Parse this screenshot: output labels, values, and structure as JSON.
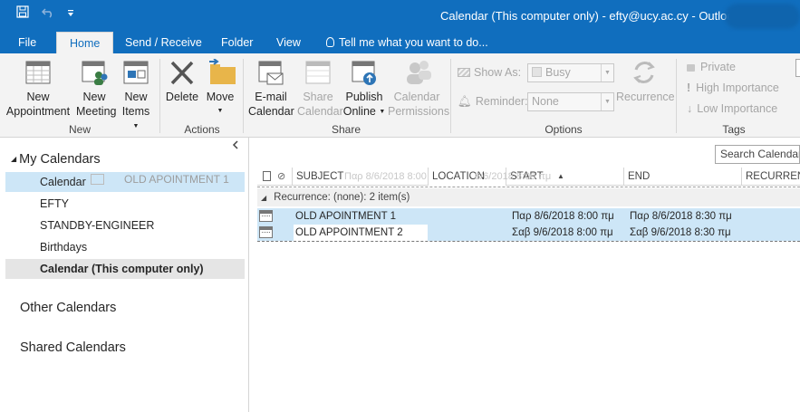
{
  "window": {
    "title": "Calendar (This computer only) - efty@ucy.ac.cy - Outlook"
  },
  "qat": {
    "save_icon": "save-icon",
    "undo_icon": "undo-icon",
    "customize_icon": "customize-icon"
  },
  "tabs": {
    "file": "File",
    "home": "Home",
    "send_receive": "Send / Receive",
    "folder": "Folder",
    "view": "View",
    "tell_me": "Tell me what you want to do..."
  },
  "ribbon": {
    "new_appointment": [
      "New",
      "Appointment"
    ],
    "new_meeting": [
      "New",
      "Meeting"
    ],
    "new_items": [
      "New",
      "Items"
    ],
    "group_new": "New",
    "delete": "Delete",
    "move": "Move",
    "group_actions": "Actions",
    "email_calendar": [
      "E-mail",
      "Calendar"
    ],
    "share_calendar": [
      "Share",
      "Calendar"
    ],
    "publish_online": [
      "Publish",
      "Online"
    ],
    "calendar_permissions": [
      "Calendar",
      "Permissions"
    ],
    "group_share": "Share",
    "show_as_label": "Show As:",
    "show_as_value": "Busy",
    "reminder_label": "Reminder:",
    "reminder_value": "None",
    "recurrence": "Recurrence",
    "group_options": "Options",
    "private": "Private",
    "high_importance": "High Importance",
    "low_importance": "Low Importance",
    "group_tags": "Tags"
  },
  "nav": {
    "my_calendars": "My Calendars",
    "items": [
      "Calendar",
      "EFTY",
      "STANDBY-ENGINEER",
      "Birthdays",
      "Calendar (This computer only)"
    ],
    "other_calendars": "Other Calendars",
    "shared_calendars": "Shared Calendars",
    "drag_ghost": "OLD APOINTMENT 1"
  },
  "main": {
    "search_placeholder": "Search Calendar (Ctrl+E)",
    "columns": {
      "subject": "SUBJECT",
      "location": "LOCATION",
      "start": "START",
      "end": "END",
      "recurrence": "RECURRENCE"
    },
    "ghost_header": "Παρ 8/6/2018 8:00",
    "ghost_header2": "8/6/2018 8:00 πμ",
    "group": "Recurrence: (none): 2 item(s)",
    "rows": [
      {
        "subject": "OLD APOINTMENT 1",
        "start": "Παρ 8/6/2018 8:00 πμ",
        "end": "Παρ 8/6/2018 8:30 πμ"
      },
      {
        "subject": "OLD APPOINTMENT 2",
        "start": "Σαβ 9/6/2018 8:00 πμ",
        "end": "Σαβ 9/6/2018 8:30 πμ"
      }
    ]
  }
}
